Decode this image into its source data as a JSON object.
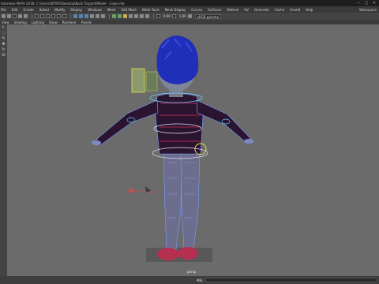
{
  "window": {
    "title": "Autodesk MAYA 2018: C:\\Users\\NITRO\\Desktop\\Back To\\pant\\Model - Copie.mb",
    "controls": [
      "−",
      "□",
      "✕"
    ]
  },
  "menubar": {
    "items": [
      "File",
      "Edit",
      "Create",
      "Select",
      "Modify",
      "Display",
      "Windows",
      "Mesh",
      "Edit Mesh",
      "Mesh Tools",
      "Mesh Display",
      "Curves",
      "Surfaces",
      "Deform",
      "UV",
      "Generate",
      "Cache",
      "Arnold",
      "Help"
    ],
    "workspace": "Workspace"
  },
  "statusline": {
    "values": [
      "0.00",
      "1.00"
    ],
    "renderer_field": "sRGB gamma"
  },
  "panel_menu": {
    "items": [
      "View",
      "Shading",
      "Lighting",
      "Show",
      "Renderer",
      "Panels"
    ]
  },
  "toolbox": {
    "tools": [
      "select-tool",
      "lasso-tool",
      "paint-tool",
      "move-tool",
      "rotate-tool",
      "scale-tool"
    ]
  },
  "viewport": {
    "camera": "persp",
    "background": "#6b6b6b"
  },
  "helpline": {
    "label": "MEL"
  },
  "colors": {
    "hair": "#1f2fb8",
    "sweater": "#2a1430",
    "jeans": "#6d6d8e",
    "shoes": "#b4304f",
    "wireframe": "#7aa0ff",
    "rig_curve": "#6ad0ff",
    "accent_yellow": "#e6e14a"
  }
}
